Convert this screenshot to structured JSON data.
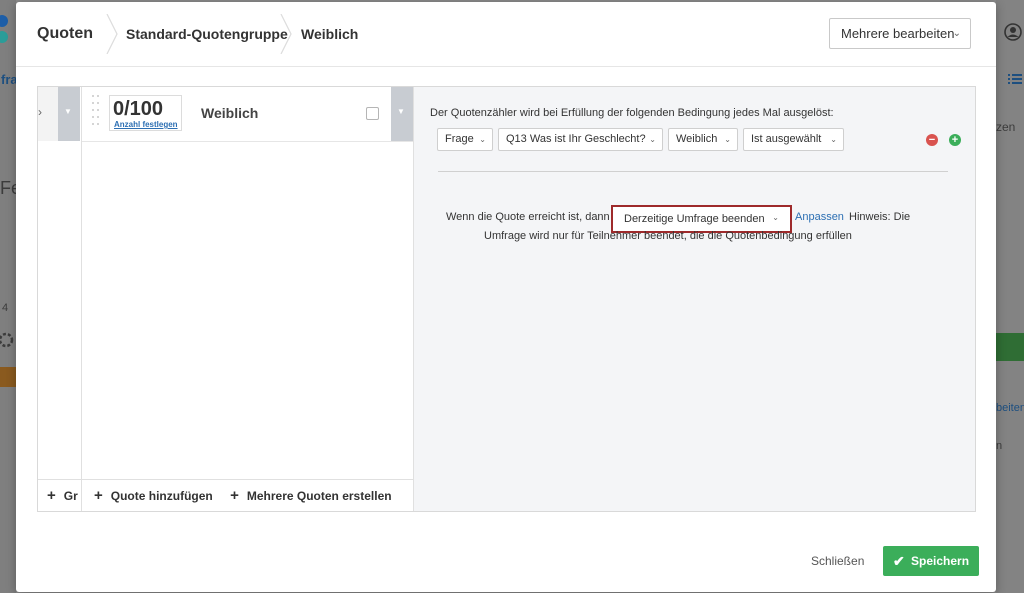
{
  "background": {
    "left_text": [
      "fra",
      "Fe",
      "4"
    ],
    "right_text": [
      "zen",
      "beiten",
      "n"
    ]
  },
  "header": {
    "crumbs": [
      "Quoten",
      "Standard-Quotengruppe",
      "Weiblich"
    ],
    "multi_edit_label": "Mehrere bearbeiten"
  },
  "left_column": {
    "footer_label": "Gr"
  },
  "quota": {
    "count": "0/100",
    "set_count_link": "Anzahl festlegen",
    "name": "Weiblich"
  },
  "list_footer": {
    "add_quota": "Quote hinzufügen",
    "add_multiple": "Mehrere Quoten erstellen"
  },
  "condition": {
    "label": "Der Quotenzähler wird bei Erfüllung der folgenden Bedingung jedes Mal ausgelöst:",
    "selects": [
      "Frage",
      "Q13 Was ist Ihr Geschlecht?",
      "Weiblich",
      "Ist ausgewählt"
    ]
  },
  "action": {
    "prefix": "Wenn die Quote erreicht ist, dann",
    "selected": "Derzeitige Umfrage beenden",
    "customize_link": "Anpassen",
    "hint_start": "Hinweis: Die",
    "hint_rest": "Umfrage wird nur für Teilnehmer beendet, die die Quotenbedingung erfüllen"
  },
  "footer": {
    "close_label": "Schließen",
    "save_label": "Speichern"
  },
  "colors": {
    "save_green": "#3bae5a",
    "highlight_red": "#9e2a2b",
    "link_blue": "#2c6fb3"
  }
}
